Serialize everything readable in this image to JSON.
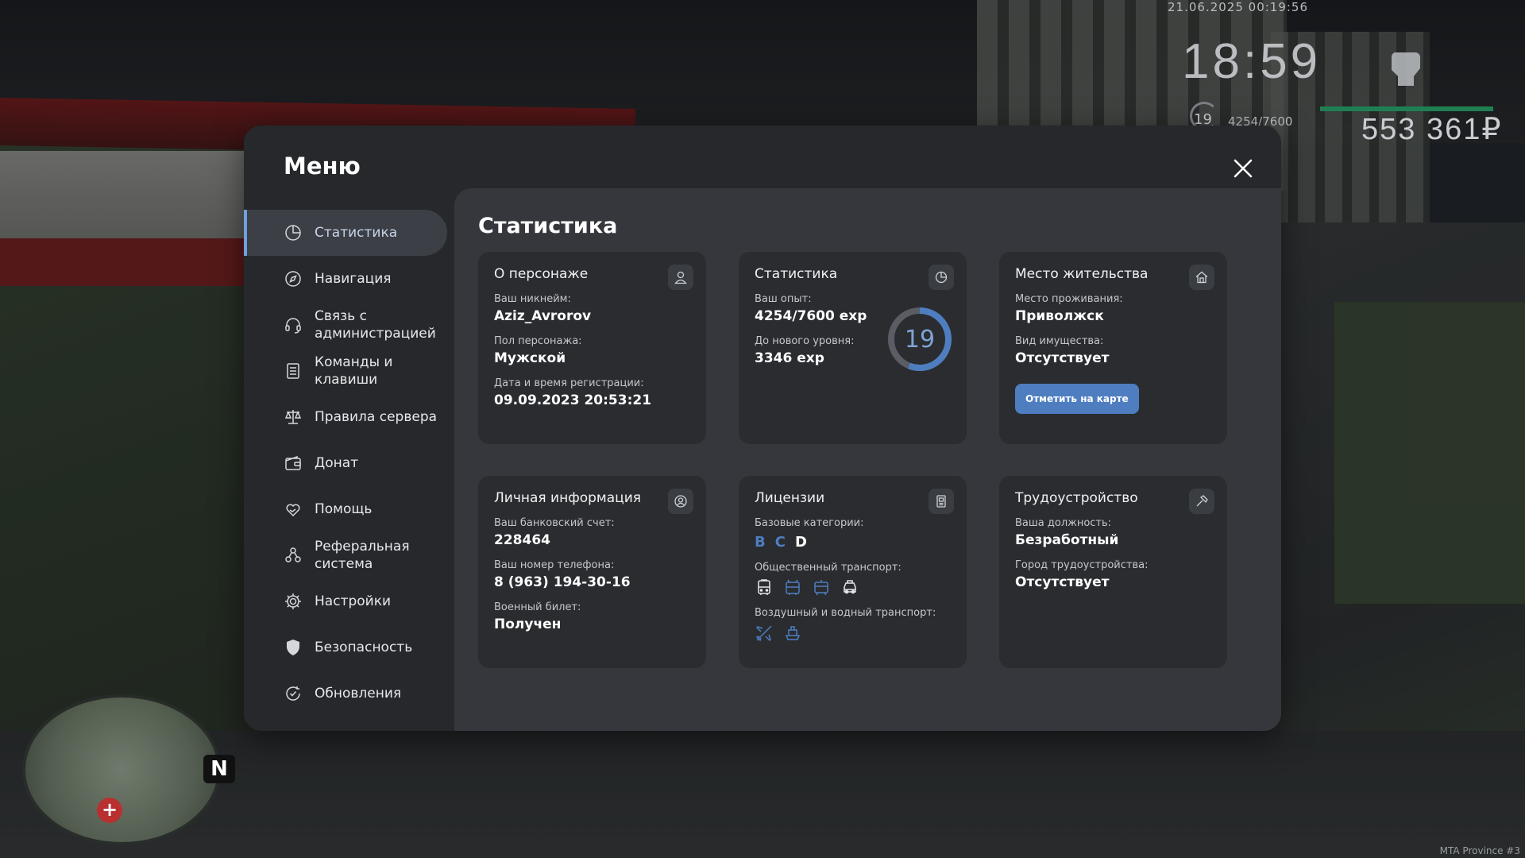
{
  "hud": {
    "datetime": "21.06.2025 00:19:56",
    "clock": "18:59",
    "level": "19",
    "exp": "4254/7600",
    "money": "553 361₽",
    "watermark": "MTA Province #3"
  },
  "minimap": {
    "north": "N",
    "hospital": "+"
  },
  "menu": {
    "title": "Меню",
    "nav": [
      {
        "label": "Статистика",
        "icon": "pie-chart-icon",
        "active": true
      },
      {
        "label": "Навигация",
        "icon": "compass-icon"
      },
      {
        "label": "Связь с администрацией",
        "icon": "headset-icon"
      },
      {
        "label": "Команды и клавиши",
        "icon": "document-icon"
      },
      {
        "label": "Правила сервера",
        "icon": "scales-icon"
      },
      {
        "label": "Донат",
        "icon": "wallet-icon"
      },
      {
        "label": "Помощь",
        "icon": "heart-hand-icon"
      },
      {
        "label": "Реферальная система",
        "icon": "people-icon"
      },
      {
        "label": "Настройки",
        "icon": "gear-icon"
      },
      {
        "label": "Безопасность",
        "icon": "shield-icon"
      },
      {
        "label": "Обновления",
        "icon": "refresh-check-icon"
      }
    ]
  },
  "content": {
    "title": "Статистика",
    "character": {
      "title": "О персонаже",
      "nickname_label": "Ваш никнейм:",
      "nickname": "Aziz_Avrorov",
      "gender_label": "Пол персонажа:",
      "gender": "Мужской",
      "reg_label": "Дата и время регистрации:",
      "reg": "09.09.2023 20:53:21"
    },
    "stats": {
      "title": "Статистика",
      "exp_label": "Ваш опыт:",
      "exp": "4254/7600 exp",
      "next_label": "До нового уровня:",
      "next": "3346 exp",
      "level": "19",
      "progress": 0.56
    },
    "residence": {
      "title": "Место жительства",
      "place_label": "Место проживания:",
      "place": "Приволжск",
      "property_label": "Вид имущества:",
      "property": "Отсутствует",
      "button": "Отметить на карте"
    },
    "personal": {
      "title": "Личная информация",
      "bank_label": "Ваш банковский счет:",
      "bank": "228464",
      "phone_label": "Ваш номер телефона:",
      "phone": "8 (963) 194-30-16",
      "military_label": "Военный билет:",
      "military": "Получен"
    },
    "licenses": {
      "title": "Лицензии",
      "base_label": "Базовые категории:",
      "base": [
        "B",
        "C",
        "D"
      ],
      "public_label": "Общественный транспорт:",
      "air_label": "Воздушный и водный транспорт:"
    },
    "employment": {
      "title": "Трудоустройство",
      "position_label": "Ваша должность:",
      "position": "Безработный",
      "city_label": "Город трудоустройства:",
      "city": "Отсутствует"
    }
  },
  "colors": {
    "accent": "#4e7ec0",
    "panel": "#26282c",
    "content": "#35373c",
    "card": "#2a2c30"
  }
}
